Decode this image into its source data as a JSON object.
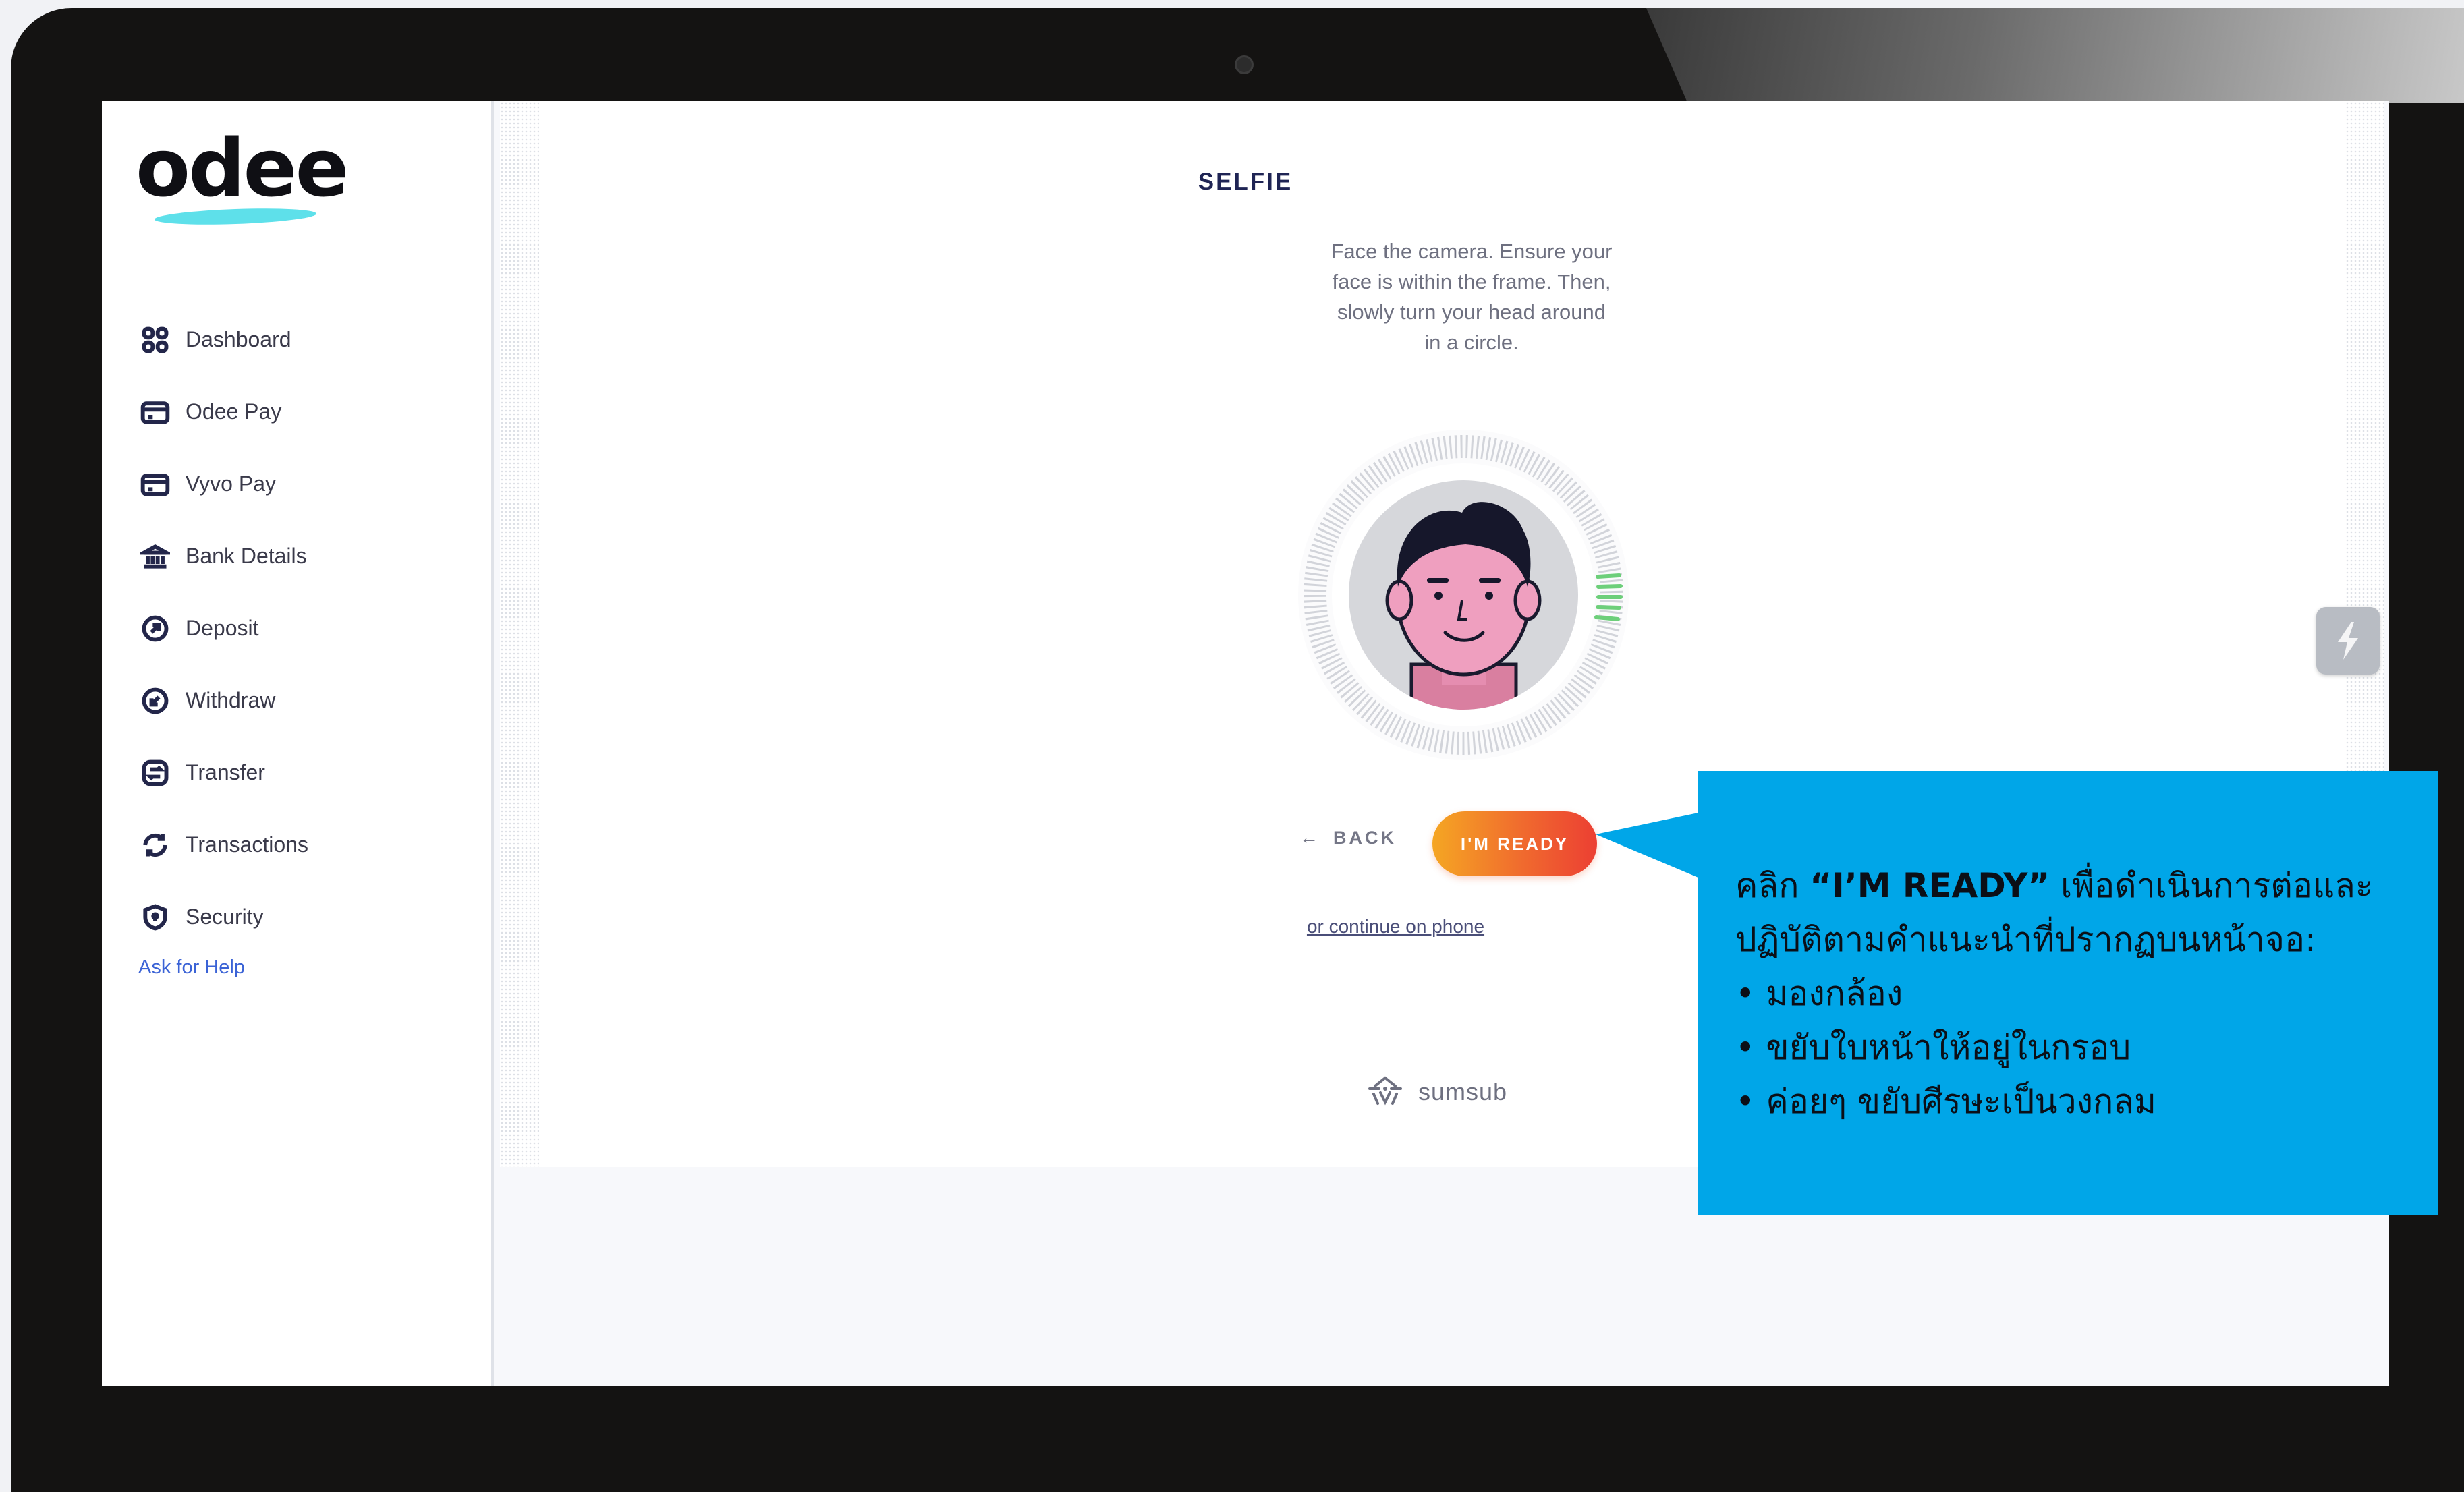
{
  "app": {
    "logo_text": "odee",
    "accent_color": "#5ee0ea"
  },
  "sidebar": {
    "items": [
      {
        "label": "Dashboard",
        "icon": "dashboard-grid-icon"
      },
      {
        "label": "Odee Pay",
        "icon": "card-icon"
      },
      {
        "label": "Vyvo Pay",
        "icon": "card-icon"
      },
      {
        "label": "Bank Details",
        "icon": "bank-icon"
      },
      {
        "label": "Deposit",
        "icon": "arrow-up-circle-icon"
      },
      {
        "label": "Withdraw",
        "icon": "arrow-down-circle-icon"
      },
      {
        "label": "Transfer",
        "icon": "transfer-icon"
      },
      {
        "label": "Transactions",
        "icon": "refresh-icon"
      },
      {
        "label": "Security",
        "icon": "shield-icon"
      }
    ],
    "help_label": "Ask for Help"
  },
  "selfie": {
    "title": "SELFIE",
    "instructions": "Face the camera. Ensure your face is within the frame. Then, slowly turn your head around in a circle.",
    "back_label": "BACK",
    "ready_label": "I'M READY",
    "phone_link": "or continue on phone",
    "brand": "sumsub",
    "button_gradient": [
      "#f5a623",
      "#ec3f33"
    ]
  },
  "callout": {
    "prefix": "คลิก ",
    "emphasis": "“I’M READY”",
    "text": " เพื่อดำเนินการต่อและปฏิบัติตามคำแนะนำที่ปรากฏบนหน้าจอ:",
    "bullets": [
      "มองกล้อง",
      "ขยับใบหน้าให้อยู่ในกรอบ",
      "ค่อยๆ ขยับศีรษะเป็นวงกลม"
    ],
    "color": "#00a6e8"
  }
}
